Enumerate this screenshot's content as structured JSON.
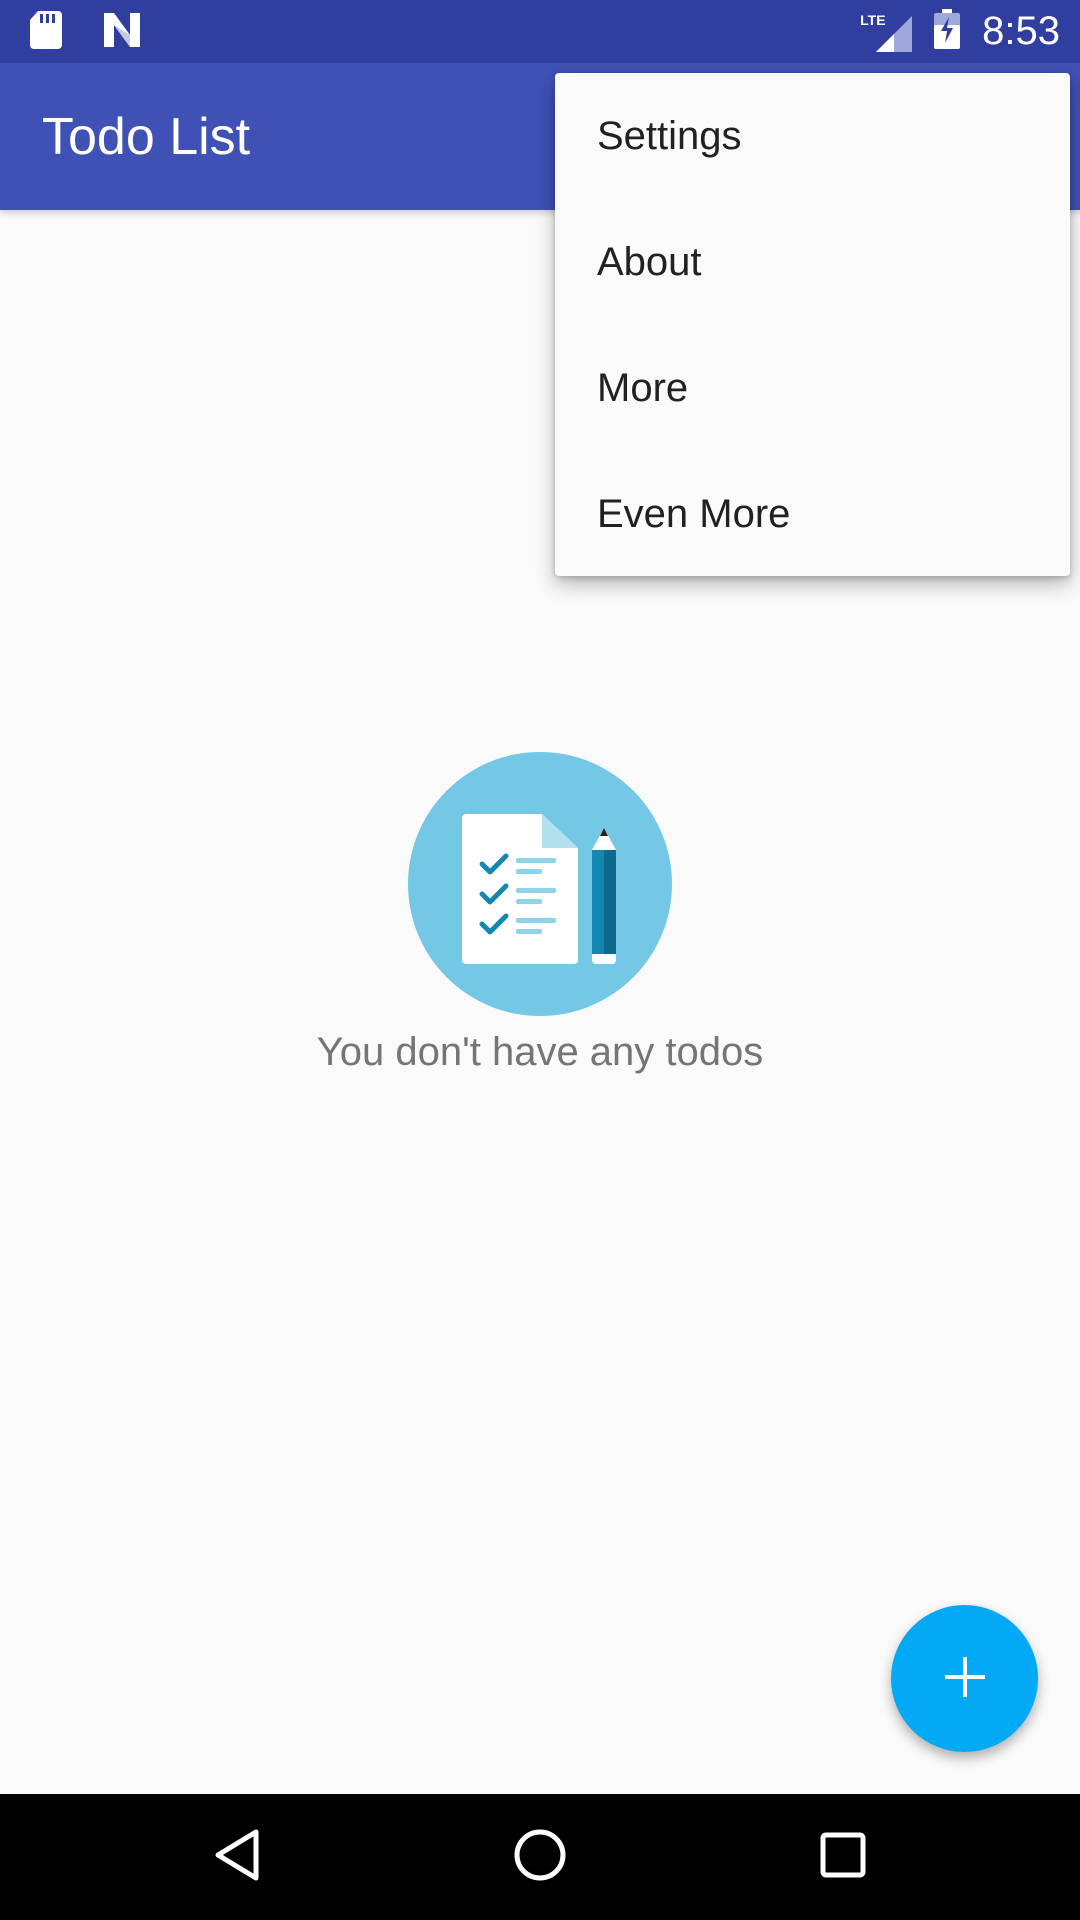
{
  "status_bar": {
    "time": "8:53",
    "network_label": "LTE",
    "icons": [
      "sd-card-icon",
      "n-logo-icon",
      "lte-signal-icon",
      "battery-charging-icon"
    ],
    "background": "#303f9f"
  },
  "app_bar": {
    "title": "Todo List",
    "background": "#3f51b5"
  },
  "overflow_menu": {
    "items": [
      {
        "label": "Settings"
      },
      {
        "label": "About"
      },
      {
        "label": "More"
      },
      {
        "label": "Even More"
      }
    ]
  },
  "empty_state": {
    "message": "You don't have any todos",
    "illustration": "todo-checklist-icon"
  },
  "fab": {
    "icon": "plus-icon",
    "color": "#03a9f4"
  },
  "nav_bar": {
    "buttons": [
      "back-icon",
      "home-icon",
      "recents-icon"
    ]
  }
}
